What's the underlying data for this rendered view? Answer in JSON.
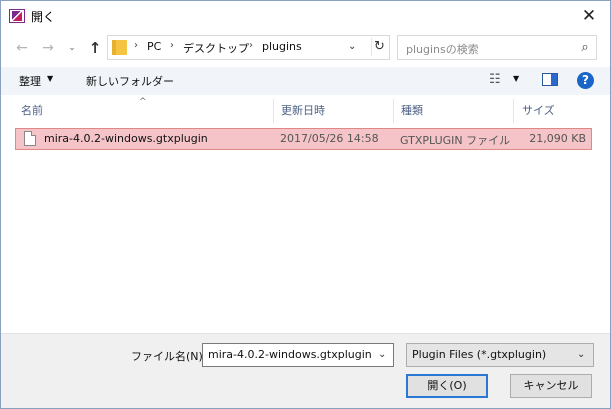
{
  "window": {
    "title": "開く",
    "close_glyph": "✕"
  },
  "nav": {
    "back": "←",
    "forward": "→",
    "recent": "⌄",
    "up": "↑"
  },
  "address": {
    "breadcrumbs": [
      "PC",
      "デスクトップ",
      "plugins"
    ],
    "separator": "›",
    "dropdown": "⌄",
    "refresh": "↻"
  },
  "search": {
    "placeholder": "pluginsの検索",
    "icon": "⌕"
  },
  "toolbar": {
    "organize_label": "整理",
    "organize_dd": "▼",
    "new_folder_label": "新しいフォルダー",
    "view_icon": "☷",
    "view_dd": "▼",
    "help": "?"
  },
  "columns": {
    "name": "名前",
    "date": "更新日時",
    "type": "種類",
    "size": "サイズ",
    "sort": "^"
  },
  "files": [
    {
      "name": "mira-4.0.2-windows.gtxplugin",
      "date": "2017/05/26 14:58",
      "type": "GTXPLUGIN ファイル",
      "size": "21,090 KB"
    }
  ],
  "footer": {
    "filename_label": "ファイル名(N):",
    "filename_value": "mira-4.0.2-windows.gtxplugin",
    "filename_dd": "⌄",
    "filter_value": "Plugin Files (*.gtxplugin)",
    "filter_dd": "⌄",
    "open_label": "開く(O)",
    "cancel_label": "キャンセル"
  },
  "colors": {
    "selection_bg": "#f4c4c8",
    "selection_border": "#e08888",
    "accent": "#2b78d4"
  }
}
